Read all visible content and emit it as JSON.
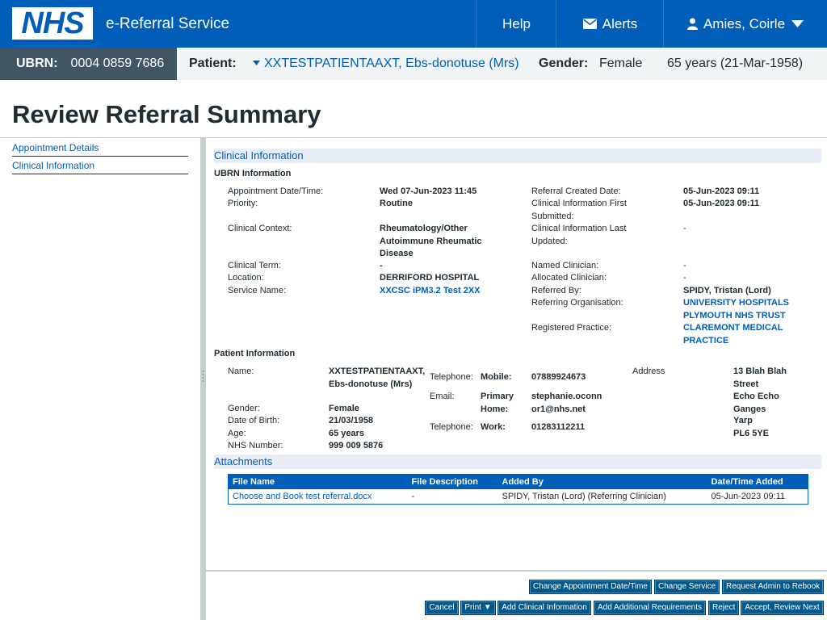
{
  "header": {
    "logo_text": "NHS",
    "service_name": "e-Referral Service",
    "help": "Help",
    "alerts": "Alerts",
    "user": "Amies, Coirle"
  },
  "banner": {
    "ubrn_label": "UBRN:",
    "ubrn_value": "0004 0859 7686",
    "patient_label": "Patient:",
    "patient_value": "XXTESTPATIENTAAXT, Ebs-donotuse (Mrs)",
    "gender_label": "Gender:",
    "gender_value": "Female",
    "age_dob": "65 years (21-Mar-1958)"
  },
  "page_title": "Review Referral Summary",
  "leftnav": [
    "Appointment Details",
    "Clinical Information"
  ],
  "clinical": {
    "section_title": "Clinical Information",
    "ubrn_heading": "UBRN Information",
    "appt_label": "Appointment Date/Time:",
    "appt_value": "Wed 07-Jun-2023 11:45",
    "priority_label": "Priority:",
    "priority_value": "Routine",
    "context_label": "Clinical Context:",
    "context_value": "Rheumatology/Other Autoimmune Rheumatic Disease",
    "term_label": "Clinical Term:",
    "term_value": "-",
    "location_label": "Location:",
    "location_value": "DERRIFORD HOSPITAL",
    "service_label": "Service Name:",
    "service_value": "XXCSC iPM3.2 Test 2XX",
    "created_label": "Referral Created Date:",
    "created_value": "05-Jun-2023 09:11",
    "first_label": "Clinical Information First Submitted:",
    "first_value": "05-Jun-2023 09:11",
    "last_label": "Clinical Information Last Updated:",
    "last_value": "-",
    "named_label": "Named Clinician:",
    "named_value": "-",
    "allocated_label": "Allocated Clinician:",
    "allocated_value": "-",
    "referred_label": "Referred By:",
    "referred_value": "SPIDY, Tristan (Lord)",
    "org_label": "Referring Organisation:",
    "org_value": "UNIVERSITY HOSPITALS PLYMOUTH NHS TRUST",
    "practice_label": "Registered Practice:",
    "practice_value": "CLAREMONT MEDICAL PRACTICE"
  },
  "patient": {
    "heading": "Patient Information",
    "name_label": "Name:",
    "name_value": "XXTESTPATIENTAAXT, Ebs-donotuse (Mrs)",
    "gender_label": "Gender:",
    "gender_value": "Female",
    "dob_label": "Date of Birth:",
    "dob_value": "21/03/1958",
    "age_label": "Age:",
    "age_value": "65 years",
    "nhs_label": "NHS Number:",
    "nhs_value": "999 009 5876",
    "tel_label": "Telephone:",
    "mobile_label": "Mobile:",
    "mobile_value": "07889924673",
    "email_label": "Email:",
    "primary_label": "Primary Home:",
    "email_value": "stephanie.oconnor1@nhs.net",
    "work_label": "Work:",
    "work_value": "01283112211",
    "address_label": "Address",
    "address_lines": [
      "13 Blah Blah Street",
      "Echo Echo Ganges",
      "Yarp",
      "PL6 5YE"
    ]
  },
  "attachments": {
    "section_title": "Attachments",
    "columns": [
      "File Name",
      "File Description",
      "Added By",
      "Date/Time Added"
    ],
    "rows": [
      {
        "file": "Choose and Book test referral.docx",
        "desc": "-",
        "added_by": "SPIDY, Tristan (Lord) (Referring Clinician)",
        "date": "05-Jun-2023 09:11"
      }
    ]
  },
  "buttons": {
    "change_appt": "Change Appointment Date/Time",
    "change_service": "Change Service",
    "request_rebook": "Request Admin to Rebook",
    "cancel": "Cancel",
    "print": "Print ▼",
    "add_clinical": "Add Clinical Information",
    "add_requirements": "Add Additional Requirements",
    "reject": "Reject",
    "accept": "Accept, Review Next"
  }
}
